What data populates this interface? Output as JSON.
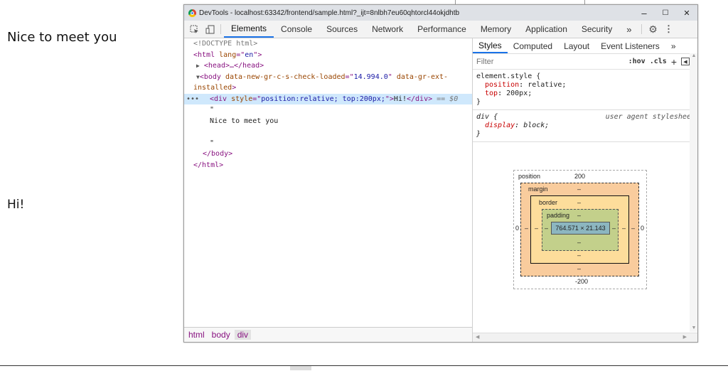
{
  "page": {
    "greeting": "Nice to meet you",
    "hi": "Hi!"
  },
  "window": {
    "title": "DevTools - localhost:63342/frontend/sample.html?_ijt=8nlbh7eu60qhtorcl44okjdhtb",
    "minimize": "–",
    "maximize": "☐",
    "close": "✕"
  },
  "toolbar": {
    "tabs": [
      "Elements",
      "Console",
      "Sources",
      "Network",
      "Performance",
      "Memory",
      "Application",
      "Security"
    ],
    "more": "»",
    "settings": "⚙",
    "kebab": "⋮"
  },
  "elements": {
    "doctype": "<!DOCTYPE html>",
    "html_open_tag": "<html",
    "html_lang_attr": " lang",
    "html_lang_eq": "=\"",
    "html_lang_val": "en",
    "html_lang_close": "\">",
    "head": "<head>…</head>",
    "body_tag": "<body",
    "body_attr1": " data-new-gr-c-s-check-loaded",
    "body_attr1_eq": "=\"",
    "body_attr1_val": "14.994.0",
    "body_attr1_close": "\"",
    "body_attr2": " data-gr-ext-",
    "body_attr2_cont": "installed",
    "body_close": ">",
    "div_tag": "<div",
    "div_attr": " style",
    "div_eq": "=\"",
    "div_val": "position:relative; top:200px;",
    "div_close": "\">",
    "div_text": "Hi!",
    "div_end": "</div>",
    "div_eqeq": " == ",
    "div_dollar": "$0",
    "quote1": "\"",
    "text_node": "Nice to meet you",
    "quote2": "\"",
    "body_end": "</body>",
    "html_end": "</html>"
  },
  "breadcrumb": [
    "html",
    "body",
    "div"
  ],
  "styles": {
    "subtabs": [
      "Styles",
      "Computed",
      "Layout",
      "Event Listeners"
    ],
    "more": "»",
    "filter_placeholder": "Filter",
    "hov": ":hov",
    "cls": ".cls",
    "plus": "+",
    "element_style_selector": "element.style {",
    "element_props": [
      {
        "prop": "position",
        "value": "relative;"
      },
      {
        "prop": "top",
        "value": "200px;"
      }
    ],
    "close_brace": "}",
    "div_selector": "div {",
    "ua_label": "user agent stylesheet",
    "div_props": [
      {
        "prop": "display",
        "value": "block;"
      }
    ]
  },
  "boxmodel": {
    "position_label": "position",
    "position_top": "200",
    "position_bottom": "-200",
    "position_left": "0",
    "position_right": "0",
    "margin_label": "margin",
    "margin_value": "–",
    "border_label": "border",
    "border_value": "–",
    "padding_label": "padding",
    "padding_value": "–",
    "content": "764.571 × 21.143",
    "dash": "–"
  },
  "colors": {
    "accent": "#1a73e8",
    "selected_row": "#cfe8fc",
    "margin_fill": "#f9cc9d",
    "border_fill": "#fddd9b",
    "padding_fill": "#c3d08b",
    "content_fill": "#8cb6c0"
  }
}
